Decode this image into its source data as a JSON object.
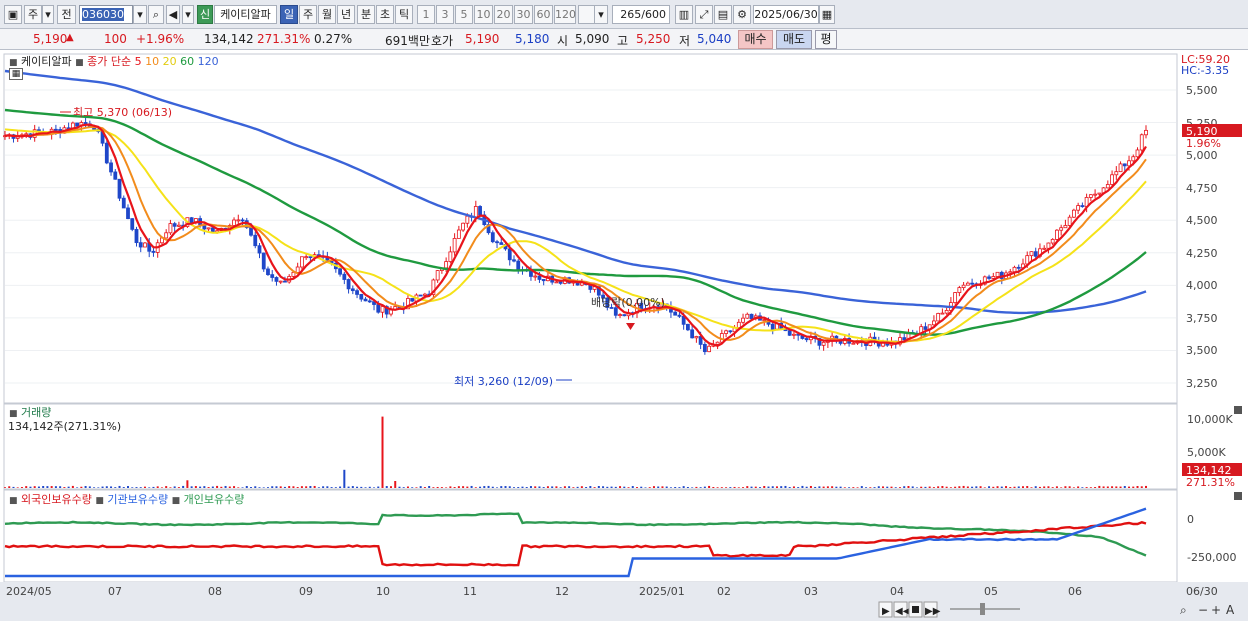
{
  "toolbar": {
    "type_label": "주",
    "all_label": "전",
    "code": "036030",
    "new_badge": "신",
    "stock_name": "케이티알파",
    "periods": [
      "일",
      "주",
      "월",
      "년",
      "분",
      "초",
      "틱"
    ],
    "active_period": "일",
    "intervals": [
      "1",
      "3",
      "5",
      "10",
      "20",
      "30",
      "60",
      "120"
    ],
    "count_value": "265",
    "count_total": "/600",
    "date": "2025/06/30"
  },
  "quote": {
    "price": "5,190",
    "change": "100",
    "change_pct": "+1.96%",
    "volume": "134,142",
    "volume_ratio": "271.31%",
    "turnover": "0.27%",
    "amount": "691백만",
    "ask_label": "호가",
    "ask": "5,190",
    "bid": "5,180",
    "open_label": "시",
    "open": "5,090",
    "high_label": "고",
    "high": "5,250",
    "low_label": "저",
    "low": "5,040",
    "buy_label": "매수",
    "sell_label": "매도",
    "flat_label": "평"
  },
  "price_panel": {
    "legend_name": "케이티알파",
    "legend_ma": "종가 단순",
    "ma_periods": [
      "5",
      "10",
      "20",
      "60",
      "120"
    ],
    "lc": "LC:59.20",
    "hc": "HC:-3.35",
    "current_price": "5,190",
    "current_pct": "1.96%",
    "high_marker": "최고 5,370 (06/13)",
    "low_marker": "최저 3,260 (12/09)",
    "dividend_marker": "배당락(0.00%)",
    "y_ticks": [
      "5,500",
      "5,250",
      "5,000",
      "4,750",
      "4,500",
      "4,250",
      "4,000",
      "3,750",
      "3,500",
      "3,250"
    ]
  },
  "volume_panel": {
    "title": "거래량",
    "current": "134,142주(271.31%)",
    "y_ticks": [
      "10,000K",
      "5,000K"
    ],
    "current_value": "134,142",
    "current_pct": "271.31%"
  },
  "holding_panel": {
    "series_labels": [
      "외국인보유수량",
      "기관보유수량",
      "개인보유수량"
    ],
    "y_ticks": [
      "0",
      "-250,000"
    ]
  },
  "x_axis": {
    "labels": [
      "2024/05",
      "07",
      "08",
      "09",
      "10",
      "11",
      "12",
      "2025/01",
      "02",
      "03",
      "04",
      "05",
      "06",
      "06/30"
    ]
  },
  "colors": {
    "ma5": "#e8141b",
    "ma10": "#f28c1c",
    "ma20": "#f5e219",
    "ma60": "#1f9a3f",
    "ma120": "#3a63d8",
    "foreign": "#e01010",
    "institution": "#2a62e0",
    "individual": "#2e9a52"
  }
}
